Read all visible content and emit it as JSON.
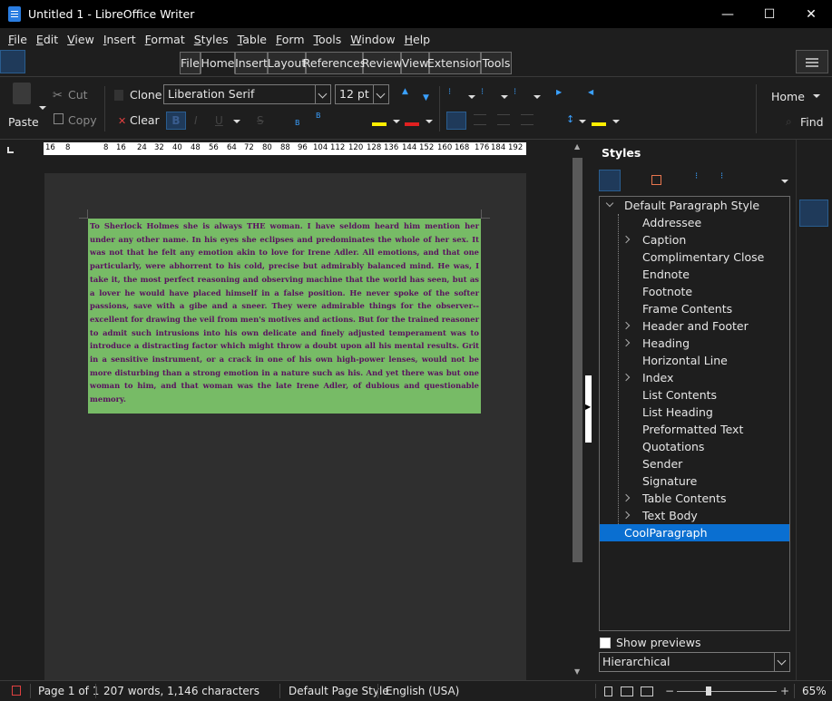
{
  "window": {
    "title": "Untitled 1 - LibreOffice Writer",
    "minimize": "—",
    "maximize": "☐",
    "close": "✕"
  },
  "menu": [
    {
      "u": "F",
      "rest": "ile"
    },
    {
      "u": "E",
      "rest": "dit"
    },
    {
      "u": "V",
      "rest": "iew"
    },
    {
      "u": "I",
      "rest": "nsert"
    },
    {
      "u": "F",
      "rest": "ormat"
    },
    {
      "u": "S",
      "rest": "tyles"
    },
    {
      "u": "T",
      "rest": "able"
    },
    {
      "u": "F",
      "rest": "orm"
    },
    {
      "u": "T",
      "rest": "ools"
    },
    {
      "u": "W",
      "rest": "indow"
    },
    {
      "u": "H",
      "rest": "elp"
    }
  ],
  "tabs": [
    "File",
    "Home",
    "Insert",
    "Layout",
    "References",
    "Review",
    "View",
    "Extension",
    "Tools"
  ],
  "ribbon": {
    "paste": "Paste",
    "cut": "Cut",
    "copy": "Copy",
    "clone": "Clone",
    "clear": "Clear",
    "font_name": "Liberation Serif",
    "font_size": "12 pt",
    "home_dropdown": "Home",
    "find": "Find"
  },
  "ruler": [
    "16",
    "8",
    "8",
    "16",
    "24",
    "32",
    "40",
    "48",
    "56",
    "64",
    "72",
    "80",
    "88",
    "96",
    "104",
    "112",
    "120",
    "128",
    "136",
    "144",
    "152",
    "160",
    "168",
    "176",
    "184",
    "192"
  ],
  "document": {
    "text": "To Sherlock Holmes she is always THE woman. I have seldom heard him mention her under any other name. In his eyes she eclipses and predominates the whole of her sex. It was not that he felt any emotion akin to love for Irene Adler. All emotions, and that one particularly, were abhorrent to his cold, precise but admirably balanced mind. He was, I take it, the most perfect reasoning and observing machine that the world has seen, but as a lover he would have placed himself in a false position. He never spoke of the softer passions, save with a gibe and a sneer. They were admirable things for the observer--excellent for drawing the veil from men's motives and actions. But for the trained reasoner to admit such intrusions into his own delicate and finely adjusted temperament was to introduce a distracting factor which might throw a doubt upon all his mental results. Grit in a sensitive instrument, or a crack in one of his own high-power lenses, would not be more disturbing than a strong emotion in a nature such as his. And yet there was but one woman to him, and that woman was the late Irene Adler, of dubious and questionable memory."
  },
  "sidebar": {
    "title": "Styles",
    "styles": [
      {
        "label": "Default Paragraph Style",
        "level": 0,
        "expandable": true,
        "expanded": true
      },
      {
        "label": "Addressee",
        "level": 1,
        "expandable": false
      },
      {
        "label": "Caption",
        "level": 1,
        "expandable": true
      },
      {
        "label": "Complimentary Close",
        "level": 1,
        "expandable": false
      },
      {
        "label": "Endnote",
        "level": 1,
        "expandable": false
      },
      {
        "label": "Footnote",
        "level": 1,
        "expandable": false
      },
      {
        "label": "Frame Contents",
        "level": 1,
        "expandable": false
      },
      {
        "label": "Header and Footer",
        "level": 1,
        "expandable": true
      },
      {
        "label": "Heading",
        "level": 1,
        "expandable": true
      },
      {
        "label": "Horizontal Line",
        "level": 1,
        "expandable": false
      },
      {
        "label": "Index",
        "level": 1,
        "expandable": true
      },
      {
        "label": "List Contents",
        "level": 1,
        "expandable": false
      },
      {
        "label": "List Heading",
        "level": 1,
        "expandable": false
      },
      {
        "label": "Preformatted Text",
        "level": 1,
        "expandable": false
      },
      {
        "label": "Quotations",
        "level": 1,
        "expandable": false
      },
      {
        "label": "Sender",
        "level": 1,
        "expandable": false
      },
      {
        "label": "Signature",
        "level": 1,
        "expandable": false
      },
      {
        "label": "Table Contents",
        "level": 1,
        "expandable": true
      },
      {
        "label": "Text Body",
        "level": 1,
        "expandable": true
      },
      {
        "label": "CoolParagraph",
        "level": 0,
        "expandable": false,
        "selected": true
      }
    ],
    "show_previews": "Show previews",
    "filter": "Hierarchical"
  },
  "status": {
    "page": "Page 1 of 1",
    "words": "207 words, 1,146 characters",
    "page_style": "Default Page Style",
    "language": "English (USA)",
    "zoom": "65%"
  },
  "colors": {
    "accent": "#0a6fd1",
    "frame_bg": "#77bb66",
    "text": "#5a1060"
  }
}
